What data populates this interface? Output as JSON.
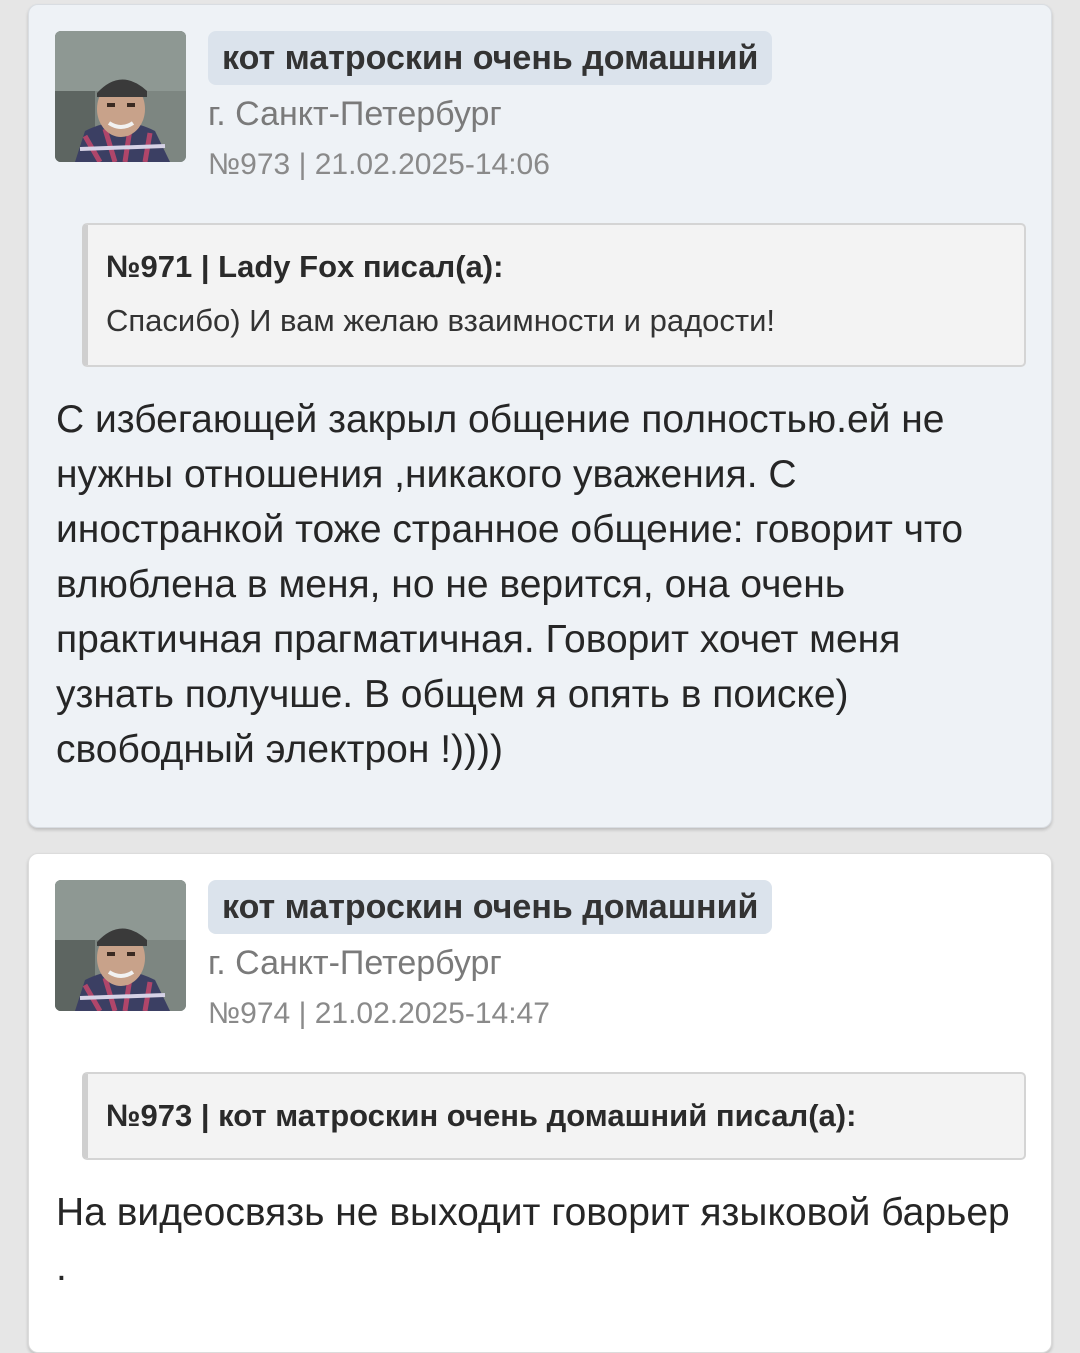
{
  "posts": [
    {
      "author": "кот матроскин очень домашний",
      "city": "г. Санкт-Петербург",
      "meta": "№973 | 21.02.2025-14:06",
      "quote": {
        "header": "№971 | Lady Fox писал(а):",
        "text": "Спасибо) И вам желаю взаимности и радости!"
      },
      "text": "С избегающей закрыл общение полностью.ей не нужны отношения ,никакого уважения. С иностранкой тоже странное общение: говорит что влюблена в меня, но не верится, она очень практичная прагматичная. Говорит хочет меня узнать получше. В общем я опять в поиске) свободный электрон !))))"
    },
    {
      "author": "кот матроскин очень домашний",
      "city": "г. Санкт-Петербург",
      "meta": "№974 | 21.02.2025-14:47",
      "quote": {
        "header": "№973 | кот матроскин очень домашний писал(а):"
      },
      "text": "На видеосвязь не выходит говорит языковой барьер ."
    }
  ]
}
